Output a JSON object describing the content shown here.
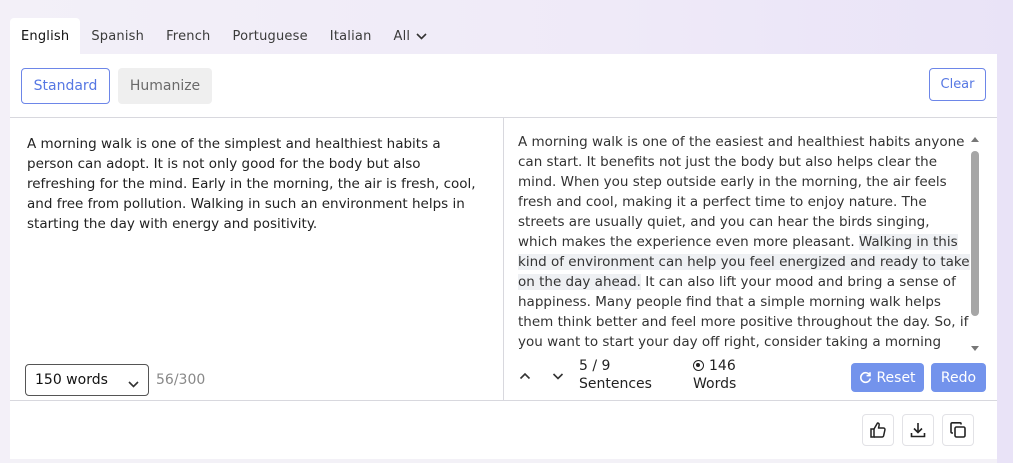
{
  "tabs": [
    {
      "label": "English",
      "active": true
    },
    {
      "label": "Spanish",
      "active": false
    },
    {
      "label": "French",
      "active": false
    },
    {
      "label": "Portuguese",
      "active": false
    },
    {
      "label": "Italian",
      "active": false
    },
    {
      "label": "All",
      "active": false
    }
  ],
  "modes": {
    "standard": "Standard",
    "humanize": "Humanize"
  },
  "toolbar": {
    "clear": "Clear"
  },
  "input": {
    "text": "A morning walk is one of the simplest and healthiest habits a person can adopt. It is not only good for the body but also refreshing for the mind. Early in the morning, the air is fresh, cool, and free from pollution. Walking in such an environment helps in starting the day with energy and positivity.",
    "word_limit_selected": "150 words",
    "word_count": "56/300"
  },
  "output": {
    "part1": "A morning walk is one of the easiest and healthiest habits anyone can start. It benefits not just the body but also helps clear the mind. When you step outside early in the morning, the air feels fresh and cool, making it a perfect time to enjoy nature. The streets are usually quiet, and you can hear the birds singing, which makes the experience even more pleasant. ",
    "highlighted": "Walking in this kind of environment can help you feel energized and ready to take on the day ahead.",
    "part2": " It can also lift your mood and bring a sense of happiness. Many people find that a simple morning walk helps them think better and feel more positive throughout the day. So, if you want to start your day off right, consider taking a morning walk. It's a simple way to improve your health and your mood all day long.",
    "sentences_count": "5 / 9",
    "sentences_label": "Sentences",
    "words_count": "146",
    "words_label": "Words",
    "reset": "Reset",
    "redo": "Redo"
  },
  "icons": [
    "chevron-down-icon",
    "chevron-up-icon",
    "refresh-icon",
    "thumbs-up-icon",
    "download-icon",
    "copy-icon"
  ],
  "colors": {
    "accent": "#5677e3",
    "button_fill": "#7393ec",
    "highlight": "#eef0f3"
  }
}
